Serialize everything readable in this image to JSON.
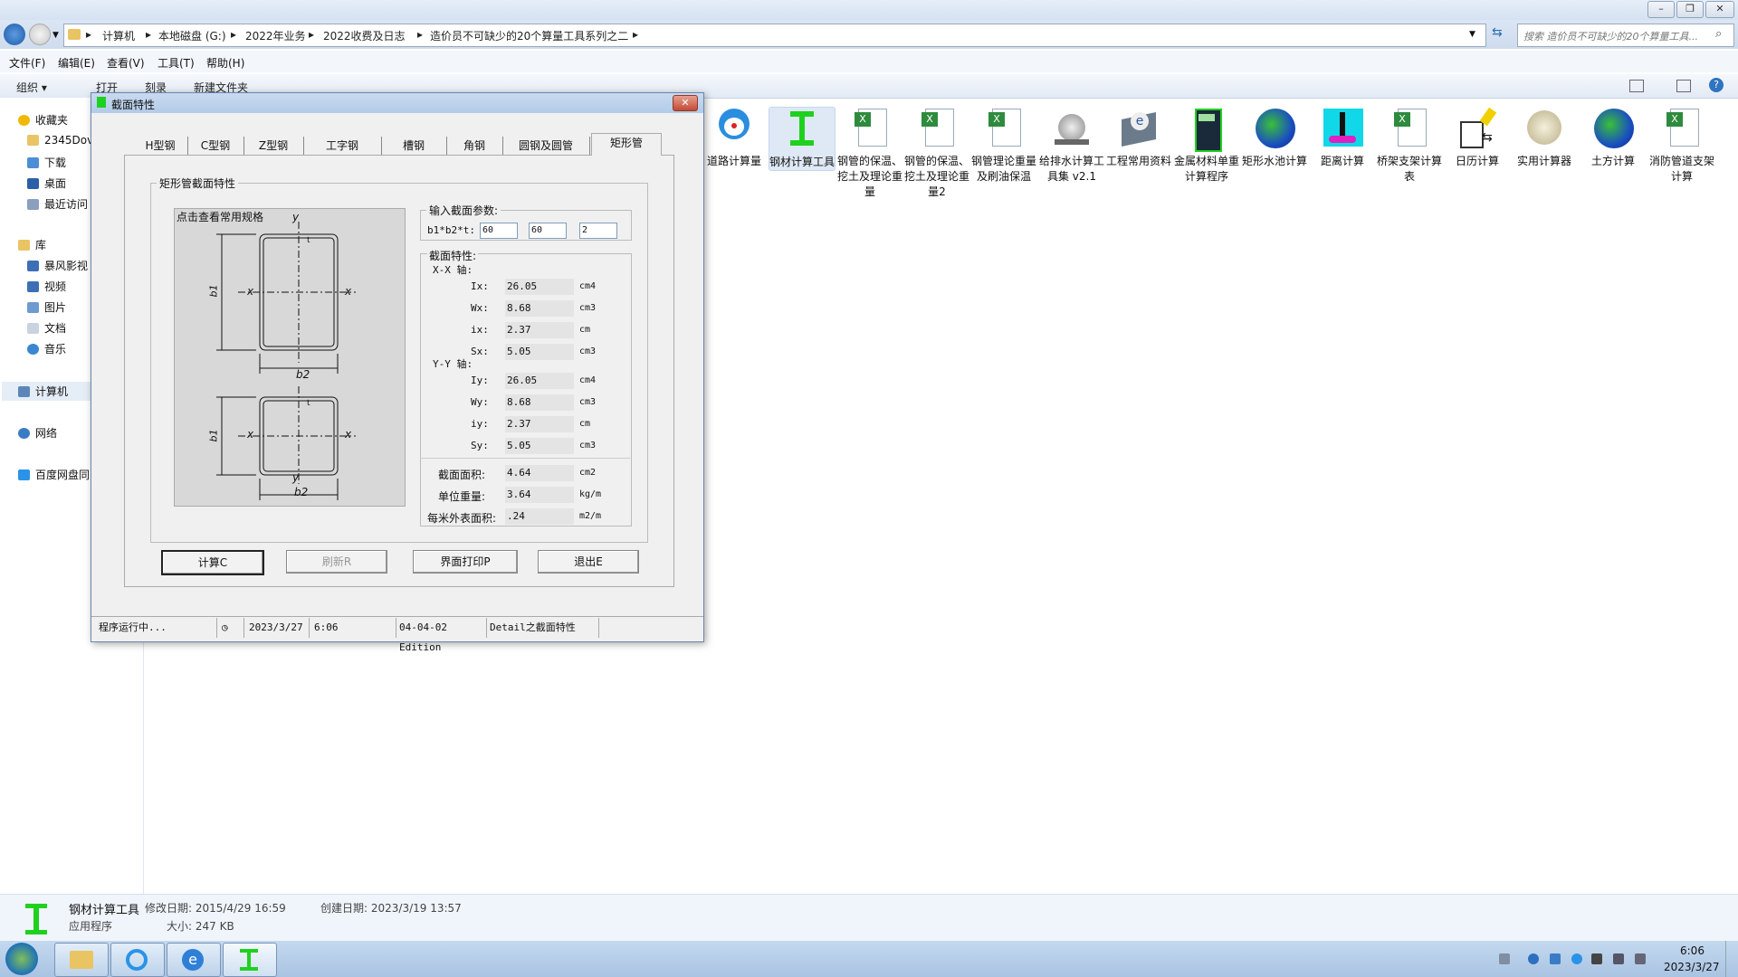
{
  "window": {
    "breadcrumbs": [
      "计算机",
      "本地磁盘 (G:)",
      "2022年业务",
      "2022收费及日志",
      "造价员不可缺少的20个算量工具系列之二"
    ],
    "search_placeholder": "搜索 造价员不可缺少的20个算量工具...",
    "menu": [
      "文件(F)",
      "编辑(E)",
      "查看(V)",
      "工具(T)",
      "帮助(H)"
    ],
    "toolbar": {
      "organize": "组织 ▾",
      "open": "打开",
      "burn": "刻录",
      "new_folder": "新建文件夹"
    }
  },
  "nav": {
    "favorites": "收藏夹",
    "fav_items": [
      "2345Dov",
      "下载",
      "桌面",
      "最近访问"
    ],
    "library": "库",
    "lib_items": [
      "暴风影视",
      "视频",
      "图片",
      "文档",
      "音乐"
    ],
    "computer": "计算机",
    "network": "网络",
    "baidu": "百度网盘同"
  },
  "files": [
    {
      "label": "道路计算量"
    },
    {
      "label": "钢材计算工具"
    },
    {
      "label": "钢管的保温、挖土及理论重量"
    },
    {
      "label": "钢管的保温、挖土及理论重量2"
    },
    {
      "label": "钢管理论重量及刷油保温"
    },
    {
      "label": "给排水计算工具集 v2.1"
    },
    {
      "label": "工程常用资料"
    },
    {
      "label": "金属材料单重计算程序"
    },
    {
      "label": "矩形水池计算"
    },
    {
      "label": "距离计算"
    },
    {
      "label": "桥架支架计算表"
    },
    {
      "label": "日历计算"
    },
    {
      "label": "实用计算器"
    },
    {
      "label": "土方计算"
    },
    {
      "label": "消防管道支架计算"
    }
  ],
  "dialog": {
    "title": "截面特性",
    "tabs": [
      "H型钢",
      "C型钢",
      "Z型钢",
      "工字钢",
      "槽钢",
      "角钢",
      "圆钢及圆管",
      "矩形管"
    ],
    "section_title": "矩形管截面特性",
    "diagram_hint": "点击查看常用规格",
    "input_group": "输入截面参数:",
    "input_label": "b1*b2*t:",
    "inputs": [
      "60",
      "60",
      "2"
    ],
    "props_group": "截面特性:",
    "xx_label": "X-X 轴:",
    "yy_label": "Y-Y 轴:",
    "xx": [
      {
        "name": "Ix:",
        "value": "26.05",
        "unit": "cm4"
      },
      {
        "name": "Wx:",
        "value": "8.68",
        "unit": "cm3"
      },
      {
        "name": "ix:",
        "value": "2.37",
        "unit": "cm"
      },
      {
        "name": "Sx:",
        "value": "5.05",
        "unit": "cm3"
      }
    ],
    "yy": [
      {
        "name": "Iy:",
        "value": "26.05",
        "unit": "cm4"
      },
      {
        "name": "Wy:",
        "value": "8.68",
        "unit": "cm3"
      },
      {
        "name": "iy:",
        "value": "2.37",
        "unit": "cm"
      },
      {
        "name": "Sy:",
        "value": "5.05",
        "unit": "cm3"
      }
    ],
    "extra": [
      {
        "name": "截面面积:",
        "value": "4.64",
        "unit": "cm2"
      },
      {
        "name": "单位重量:",
        "value": "3.64",
        "unit": "kg/m"
      },
      {
        "name": "每米外表面积:",
        "value": ".24",
        "unit": "m2/m"
      }
    ],
    "buttons": {
      "calc": "计算C",
      "refresh": "刷新R",
      "print": "界面打印P",
      "exit": "退出E"
    },
    "status": {
      "running": "程序运行中...",
      "date": "2023/3/27",
      "time": "6:06",
      "edition": "04-04-02 Edition",
      "module": "Detail之截面特性"
    },
    "diagram_labels": {
      "y": "y",
      "x": "x",
      "b1": "b1",
      "b2": "b2",
      "t": "t"
    }
  },
  "details": {
    "name": "钢材计算工具",
    "type": "应用程序",
    "modified_label": "修改日期: 2015/4/29 16:59",
    "size_label": "大小: 247 KB",
    "created_label": "创建日期: 2023/3/19 13:57"
  },
  "taskbar": {
    "time": "6:06",
    "date": "2023/3/27"
  },
  "colors": {
    "green_icon": "#1fd11f",
    "accent": "#3c7fb1"
  }
}
